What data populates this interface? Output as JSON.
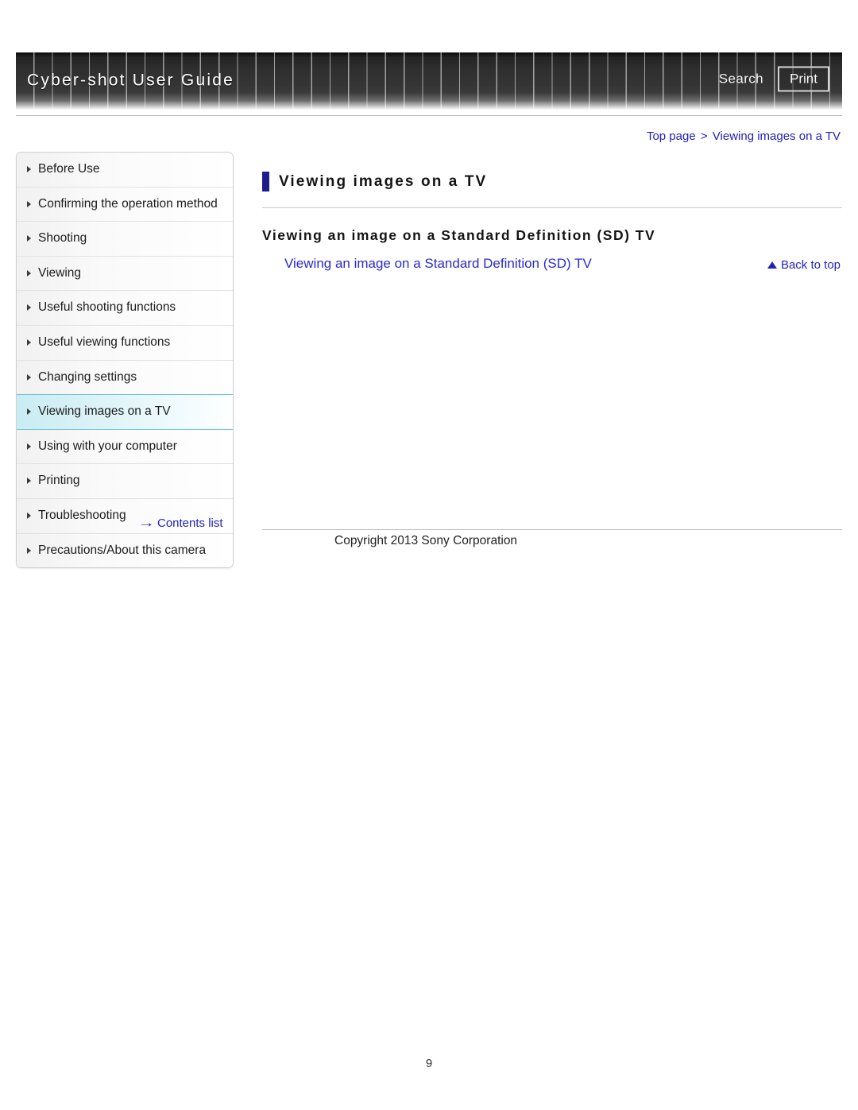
{
  "header": {
    "title": "Cyber-shot User Guide",
    "search_label": "Search",
    "print_label": "Print"
  },
  "breadcrumb": {
    "top_label": "Top page",
    "separator": ">",
    "current_label": "Viewing images on a TV"
  },
  "sidebar": {
    "items": [
      {
        "label": "Before Use",
        "active": false
      },
      {
        "label": "Confirming the operation method",
        "active": false
      },
      {
        "label": "Shooting",
        "active": false
      },
      {
        "label": "Viewing",
        "active": false
      },
      {
        "label": "Useful shooting functions",
        "active": false
      },
      {
        "label": "Useful viewing functions",
        "active": false
      },
      {
        "label": "Changing settings",
        "active": false
      },
      {
        "label": "Viewing images on a TV",
        "active": true
      },
      {
        "label": "Using with your computer",
        "active": false
      },
      {
        "label": "Printing",
        "active": false
      },
      {
        "label": "Troubleshooting",
        "active": false
      },
      {
        "label": "Precautions/About this camera",
        "active": false
      }
    ],
    "contents_list_label": "Contents list",
    "contents_list_arrow": "→"
  },
  "main": {
    "page_title": "Viewing images on a TV",
    "section_heading": "Viewing an image on a Standard Definition (SD) TV",
    "section_link": "Viewing an image on a Standard Definition (SD) TV",
    "back_to_top_label": "Back to top"
  },
  "footer": {
    "copyright": "Copyright 2013 Sony Corporation",
    "page_number": "9"
  },
  "colors": {
    "link": "#2222bb",
    "section_link": "#2a2acc",
    "title_marker": "#1c1c8c",
    "active_nav_border": "#6fc6d6",
    "header_dark": "#2f2f2f"
  }
}
